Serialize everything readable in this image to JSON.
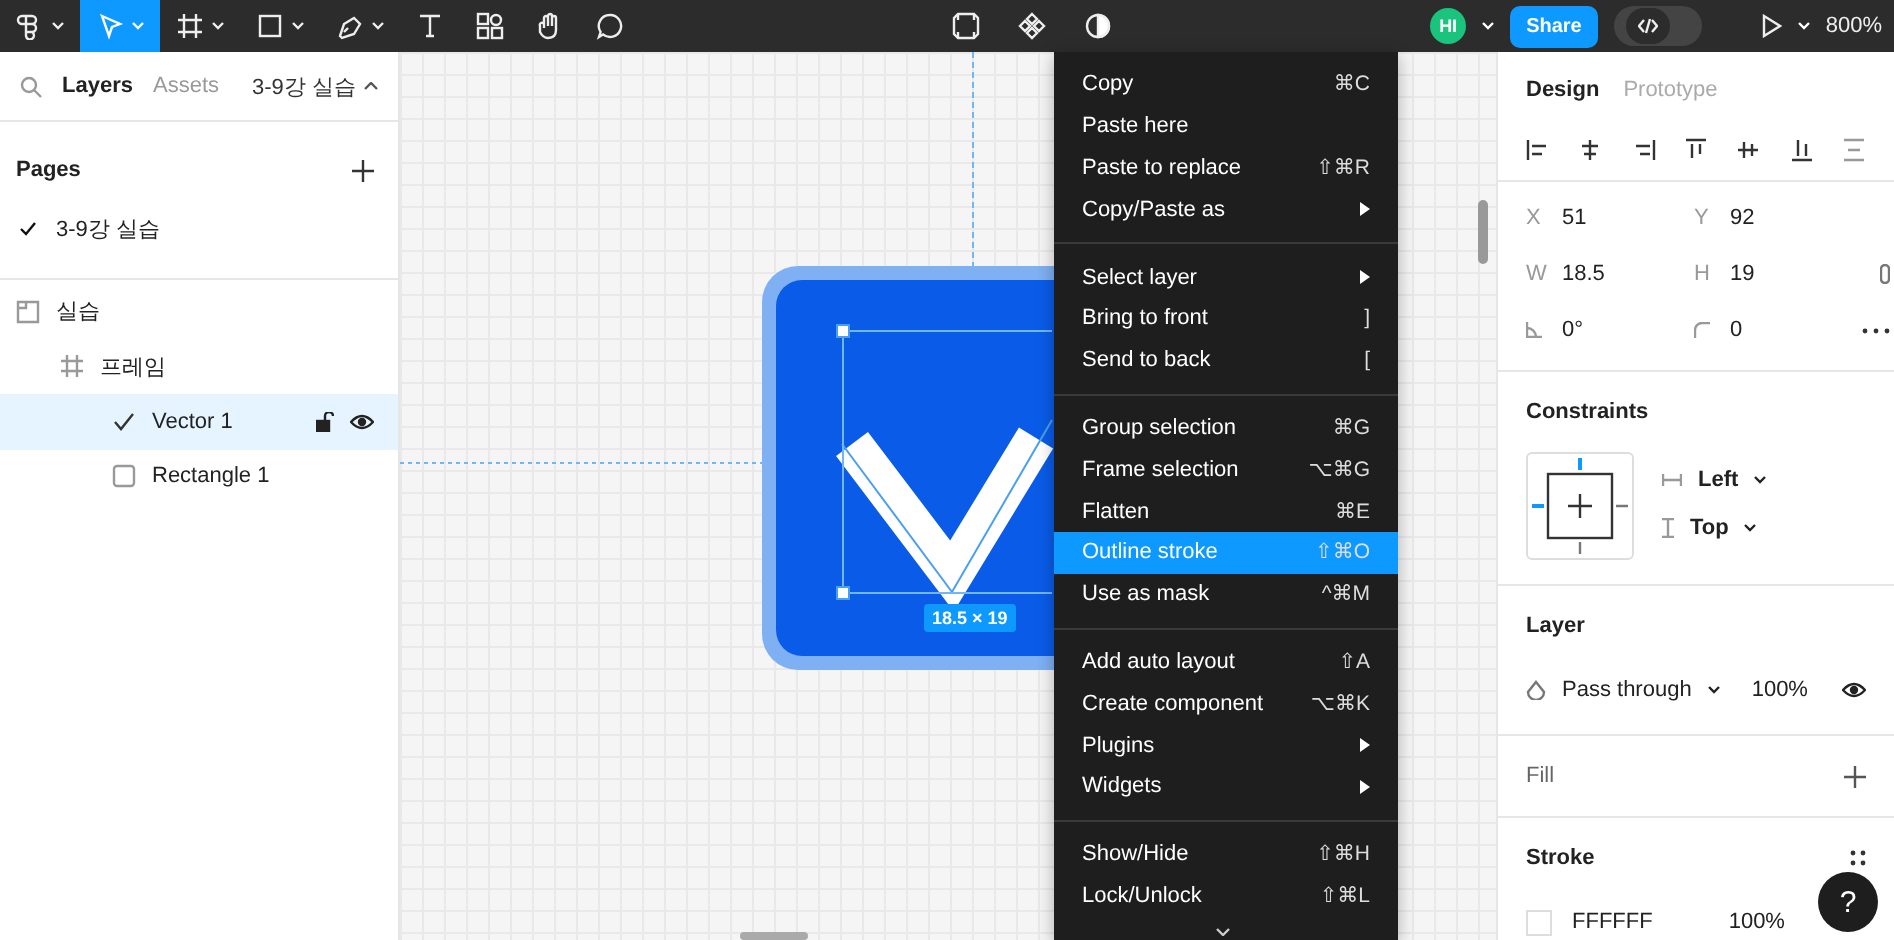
{
  "toolbar": {
    "tools": [
      {
        "kind": "main-menu",
        "selected": false,
        "has_menu": true
      },
      {
        "kind": "move",
        "selected": true,
        "has_menu": true
      },
      {
        "kind": "frame",
        "selected": false,
        "has_menu": true
      },
      {
        "kind": "shape",
        "selected": false,
        "has_menu": true
      },
      {
        "kind": "pen",
        "selected": false,
        "has_menu": true
      },
      {
        "kind": "text",
        "selected": false,
        "has_menu": false
      },
      {
        "kind": "resources",
        "selected": false,
        "has_menu": false
      },
      {
        "kind": "hand",
        "selected": false,
        "has_menu": false
      },
      {
        "kind": "comment",
        "selected": false,
        "has_menu": false
      }
    ],
    "center_tools": [
      {
        "kind": "component"
      },
      {
        "kind": "plugin"
      },
      {
        "kind": "contrast"
      }
    ],
    "avatar": "HI",
    "share": "Share",
    "dev_mode": false,
    "zoom": "800%"
  },
  "left_panel": {
    "tabs": [
      {
        "label": "Layers",
        "selected": true
      },
      {
        "label": "Assets",
        "selected": false
      }
    ],
    "page_switcher": "3-9강 실습",
    "pages_title": "Pages",
    "pages": [
      {
        "label": "3-9강 실습",
        "selected": true
      }
    ],
    "layers": [
      {
        "label": "실습",
        "kind": "section",
        "selected": false,
        "children": [
          {
            "label": "프레임",
            "kind": "frame",
            "selected": false,
            "children": [
              {
                "label": "Vector 1",
                "kind": "vector",
                "selected": true
              },
              {
                "label": "Rectangle 1",
                "kind": "rectangle",
                "selected": false
              }
            ]
          }
        ]
      }
    ]
  },
  "canvas": {
    "dimension_label": "18.5 × 19"
  },
  "context_menu": {
    "groups": [
      {
        "items": [
          {
            "label": "Copy",
            "shortcut": "⌘C",
            "submenu": false,
            "selected": false
          },
          {
            "label": "Paste here",
            "submenu": false,
            "selected": false
          },
          {
            "label": "Paste to replace",
            "shortcut": "⇧⌘R",
            "submenu": false,
            "selected": false
          },
          {
            "label": "Copy/Paste as",
            "submenu": true,
            "selected": false
          }
        ]
      },
      {
        "items": [
          {
            "label": "Select layer",
            "submenu": true,
            "selected": false
          },
          {
            "label": "Bring to front",
            "shortcut": "]",
            "submenu": false,
            "selected": false
          },
          {
            "label": "Send to back",
            "shortcut": "[",
            "submenu": false,
            "selected": false
          }
        ]
      },
      {
        "items": [
          {
            "label": "Group selection",
            "shortcut": "⌘G",
            "submenu": false,
            "selected": false
          },
          {
            "label": "Frame selection",
            "shortcut": "⌥⌘G",
            "submenu": false,
            "selected": false
          },
          {
            "label": "Flatten",
            "shortcut": "⌘E",
            "submenu": false,
            "selected": false
          },
          {
            "label": "Outline stroke",
            "shortcut": "⇧⌘O",
            "submenu": false,
            "selected": true
          },
          {
            "label": "Use as mask",
            "shortcut": "^⌘M",
            "submenu": false,
            "selected": false
          }
        ]
      },
      {
        "items": [
          {
            "label": "Add auto layout",
            "shortcut": "⇧A",
            "submenu": false,
            "selected": false
          },
          {
            "label": "Create component",
            "shortcut": "⌥⌘K",
            "submenu": false,
            "selected": false
          },
          {
            "label": "Plugins",
            "submenu": true,
            "selected": false
          },
          {
            "label": "Widgets",
            "submenu": true,
            "selected": false
          }
        ]
      },
      {
        "items": [
          {
            "label": "Show/Hide",
            "shortcut": "⇧⌘H",
            "submenu": false,
            "selected": false
          },
          {
            "label": "Lock/Unlock",
            "shortcut": "⇧⌘L",
            "submenu": false,
            "selected": false
          }
        ]
      }
    ]
  },
  "right_panel": {
    "tabs": [
      {
        "label": "Design",
        "selected": true
      },
      {
        "label": "Prototype",
        "selected": false
      }
    ],
    "fields": [
      {
        "kind": "letter",
        "label": "X",
        "value": "51"
      },
      {
        "kind": "letter",
        "label": "Y",
        "value": "92"
      },
      {
        "kind": "letter",
        "label": "W",
        "value": "18.5"
      },
      {
        "kind": "letter",
        "label": "H",
        "value": "19"
      },
      {
        "kind": "rotation",
        "value": "0°"
      },
      {
        "kind": "radius",
        "value": "0"
      }
    ],
    "constraints": {
      "title": "Constraints",
      "horizontal": "Left",
      "vertical": "Top"
    },
    "layer": {
      "title": "Layer",
      "blend": "Pass through",
      "opacity": "100%"
    },
    "fill": {
      "title": "Fill"
    },
    "stroke": {
      "title": "Stroke",
      "hex": "FFFFFF",
      "opacity": "100%"
    },
    "help": "?"
  }
}
